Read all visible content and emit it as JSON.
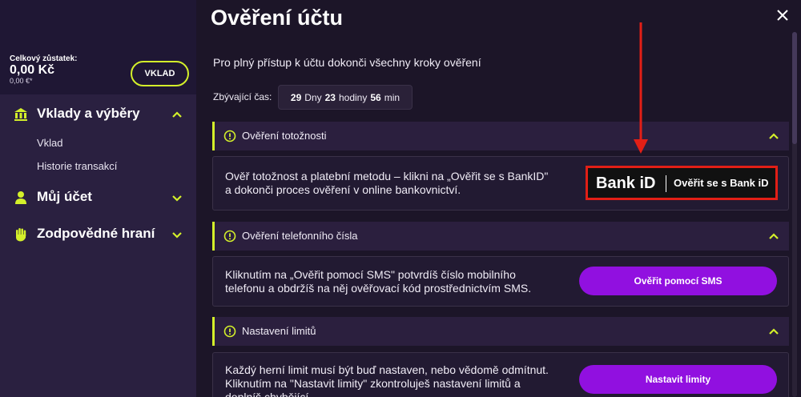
{
  "sidebar": {
    "balance_label": "Celkový zůstatek:",
    "balance_value": "0,00 Kč",
    "balance_eur": "0,00 €*",
    "deposit_button": "VKLAD",
    "items": [
      {
        "label": "Vklady a výběry",
        "icon": "bank-icon",
        "expanded": true,
        "subitems": [
          "Vklad",
          "Historie transakcí"
        ]
      },
      {
        "label": "Můj účet",
        "icon": "user-icon",
        "expanded": false
      },
      {
        "label": "Zodpovědné hraní",
        "icon": "hand-icon",
        "expanded": false
      }
    ]
  },
  "main": {
    "title": "Ověření účtu",
    "intro": "Pro plný přístup k účtu dokonči všechny kroky ověření",
    "remaining_label": "Zbývající čas:",
    "timer": {
      "days": "29",
      "days_label": "Dny",
      "hours": "23",
      "hours_label": "hodiny",
      "minutes": "56",
      "minutes_label": "min"
    },
    "sections": [
      {
        "title": "Ověření totožnosti",
        "text_line1": "Ověř totožnost a platební metodu – klikni na „Ověřit se s BankID\"",
        "text_line2": "a dokonči proces ověření v online bankovnictví.",
        "button_logo": "Bank iD",
        "button_label": "Ověřit se s Bank iD"
      },
      {
        "title": "Ověření telefonního čísla",
        "text_line1": "Kliknutím na „Ověřit pomocí SMS\" potvrdíš číslo mobilního",
        "text_line2": "telefonu a obdržíš na něj ověřovací kód prostřednictvím SMS.",
        "button_label": "Ověřit pomocí SMS"
      },
      {
        "title": "Nastavení limitů",
        "text_line1": "Každý herní limit musí být buď nastaven, nebo vědomě odmítnut.",
        "text_line2": "Kliknutím na \"Nastavit limity\" zkontroluješ nastavení limitů a",
        "text_line3": "doplníš chybějící.",
        "button_label": "Nastavit limity"
      }
    ]
  },
  "colors": {
    "accent_lime": "#d4f02a",
    "button_purple": "#9110e0",
    "highlight_red": "#e21f16",
    "background": "#1c1528",
    "sidebar": "#2a2040"
  }
}
